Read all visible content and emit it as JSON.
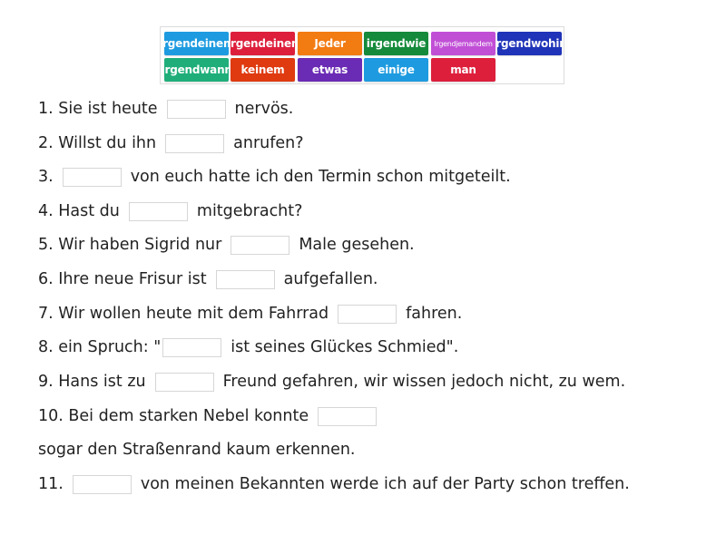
{
  "word_bank": {
    "tiles": [
      {
        "label": "Irgendeinem",
        "color": "#1e9be0"
      },
      {
        "label": "Irgendeinen",
        "color": "#dd1f3c"
      },
      {
        "label": "Jeder",
        "color": "#f27b12"
      },
      {
        "label": "irgendwie",
        "color": "#158a3b"
      },
      {
        "label": "Irgendjemandem",
        "color": "#c14fd6"
      },
      {
        "label": "irgendwohin",
        "color": "#1f34b8"
      },
      {
        "label": "Irgendwann",
        "color": "#1fae7a"
      },
      {
        "label": "keinem",
        "color": "#df3a10"
      },
      {
        "label": "etwas",
        "color": "#6a2bb5"
      },
      {
        "label": "einige",
        "color": "#1e9be0"
      },
      {
        "label": "man",
        "color": "#dd1f3c"
      }
    ]
  },
  "sentences": [
    {
      "before": "1. Sie ist heute",
      "after": "nervös."
    },
    {
      "before": "2. Willst du ihn",
      "after": "anrufen?"
    },
    {
      "before": "3.",
      "after": "von euch hatte ich den Termin schon mitgeteilt."
    },
    {
      "before": "4. Hast du",
      "after": "mitgebracht?"
    },
    {
      "before": "5. Wir haben Sigrid nur",
      "after": "Male gesehen."
    },
    {
      "before": "6. Ihre neue Frisur ist",
      "after": "aufgefallen."
    },
    {
      "before": "7. Wir wollen heute mit dem Fahrrad",
      "after": "fahren."
    },
    {
      "before": "8. ein Spruch: \"",
      "after": "ist seines Glückes Schmied\"."
    },
    {
      "before": "9. Hans ist zu",
      "after": "Freund gefahren, wir wissen jedoch nicht, zu wem."
    },
    {
      "before": "10. Bei dem starken Nebel konnte",
      "after": ""
    },
    {
      "continuation": "sogar den Straßenrand kaum erkennen."
    },
    {
      "before": "11.",
      "after": "von meinen Bekannten werde ich auf der Party schon treffen."
    }
  ]
}
